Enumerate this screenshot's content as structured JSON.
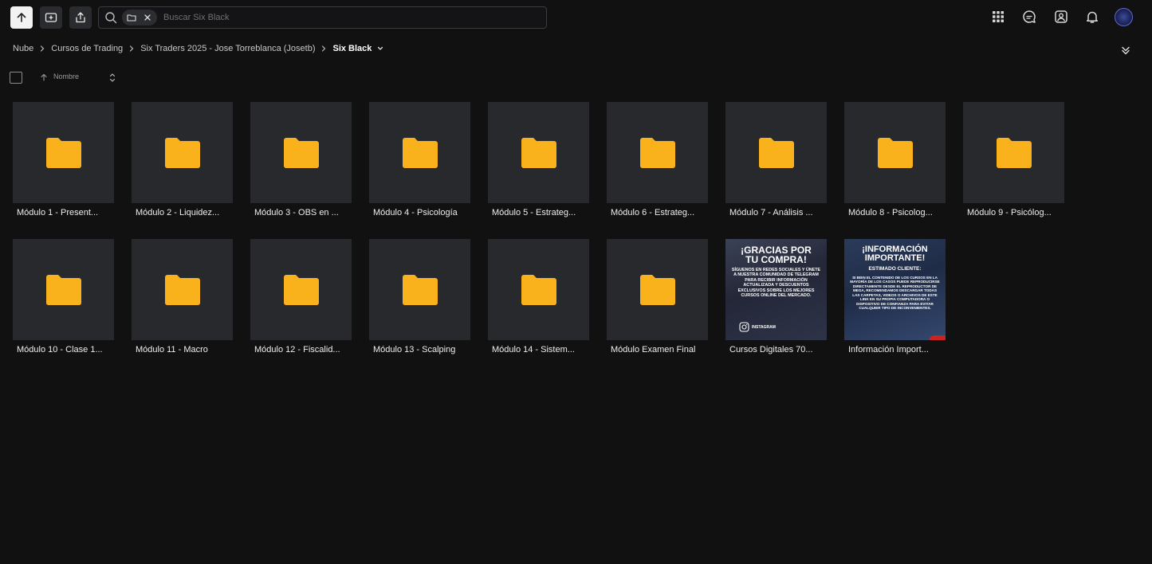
{
  "toolbar": {
    "search_placeholder": "Buscar Six Black"
  },
  "breadcrumb": {
    "items": [
      "Nube",
      "Cursos de Trading",
      "Six Traders 2025 - Jose Torreblanca (Josetb)",
      "Six Black"
    ]
  },
  "sort": {
    "label": "Nombre"
  },
  "colors": {
    "folder": "#f9b21b",
    "background": "#111112",
    "tile_bg": "#28292c"
  },
  "items": [
    {
      "name": "Módulo 1 - Present...",
      "type": "folder"
    },
    {
      "name": "Módulo 2 - Liquidez...",
      "type": "folder"
    },
    {
      "name": "Módulo 3 - OBS en ...",
      "type": "folder"
    },
    {
      "name": "Módulo 4 - Psicología",
      "type": "folder"
    },
    {
      "name": "Módulo 5 - Estrateg...",
      "type": "folder"
    },
    {
      "name": "Módulo 6 - Estrateg...",
      "type": "folder"
    },
    {
      "name": "Módulo 7 - Análisis ...",
      "type": "folder"
    },
    {
      "name": "Módulo 8 - Psicolog...",
      "type": "folder"
    },
    {
      "name": "Módulo 9 - Psicólog...",
      "type": "folder"
    },
    {
      "name": "Módulo 10 - Clase 1...",
      "type": "folder"
    },
    {
      "name": "Módulo 11 - Macro",
      "type": "folder"
    },
    {
      "name": "Módulo 12 - Fiscalid...",
      "type": "folder"
    },
    {
      "name": "Módulo 13 - Scalping",
      "type": "folder"
    },
    {
      "name": "Módulo 14 - Sistem...",
      "type": "folder"
    },
    {
      "name": "Módulo Examen Final",
      "type": "folder"
    },
    {
      "name": "Cursos Digitales 70...",
      "type": "image"
    },
    {
      "name": "Información Import...",
      "type": "image"
    }
  ],
  "image1": {
    "title_line1": "¡GRACIAS POR",
    "title_line2": "TU COMPRA!",
    "body": "SÍGUENOS EN REDES SOCIALES Y ÚNETE A NUESTRA COMUNIDAD DE TELEGRAM PARA RECIBIR INFORMACIÓN ACTUALIZADA Y DESCUENTOS EXCLUSIVOS SOBRE LOS MEJORES CURSOS ONLINE DEL MERCADO.",
    "social": "INSTAGRAM"
  },
  "image2": {
    "title_line1": "¡INFORMACIÓN",
    "title_line2": "IMPORTANTE!",
    "subtitle": "ESTIMADO CLIENTE:",
    "body": "SI BIEN EL CONTENIDO DE LOS CURSOS EN LA MAYORÍA DE LOS CASOS PUEDE REPRODUCIRSE DIRECTAMENTE DESDE EL REPRODUCTOR DE MEGA, RECOMENDAMOS DESCARGAR TODAS LAS CARPETAS, VIDEOS O ARCHIVOS DE ESTE LINK EN SU PROPIA COMPUTADORA O DISPOSITIVO DE CONFIANZA PARA EVITAR CUALQUIER TIPO DE INCONVENIENTES."
  }
}
